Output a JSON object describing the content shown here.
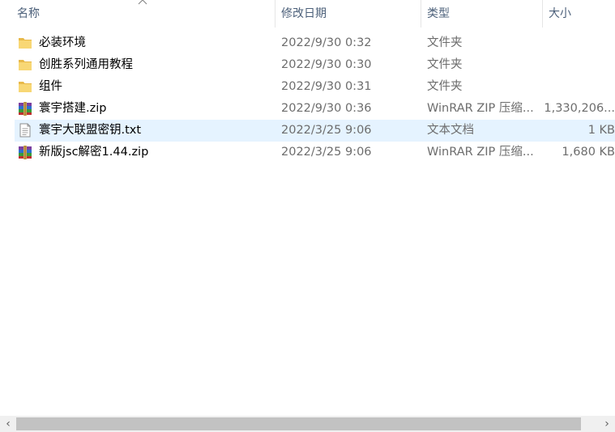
{
  "columns": {
    "name": "名称",
    "date": "修改日期",
    "type": "类型",
    "size": "大小"
  },
  "sort": {
    "column": "name",
    "direction": "ascending"
  },
  "files": [
    {
      "name": "必装环境",
      "date": "2022/9/30 0:32",
      "type": "文件夹",
      "size": "",
      "icon": "folder-icon",
      "selected": false
    },
    {
      "name": "创胜系列通用教程",
      "date": "2022/9/30 0:30",
      "type": "文件夹",
      "size": "",
      "icon": "folder-icon",
      "selected": false
    },
    {
      "name": "组件",
      "date": "2022/9/30 0:31",
      "type": "文件夹",
      "size": "",
      "icon": "folder-icon",
      "selected": false
    },
    {
      "name": "寰宇搭建.zip",
      "date": "2022/9/30 0:36",
      "type": "WinRAR ZIP 压缩...",
      "size": "1,330,206...",
      "icon": "winrar-icon",
      "selected": false
    },
    {
      "name": "寰宇大联盟密钥.txt",
      "date": "2022/3/25 9:06",
      "type": "文本文档",
      "size": "1 KB",
      "icon": "text-file-icon",
      "selected": true
    },
    {
      "name": "新版jsc解密1.44.zip",
      "date": "2022/3/25 9:06",
      "type": "WinRAR ZIP 压缩...",
      "size": "1,680 KB",
      "icon": "winrar-icon",
      "selected": false
    }
  ],
  "scrollbar": {
    "left_arrow": "‹",
    "right_arrow": "›"
  },
  "colors": {
    "selected_row": "#e5f3ff",
    "header_text": "#4c607a",
    "folder": "#f8d775",
    "scroll_thumb": "#c2c2c2"
  }
}
